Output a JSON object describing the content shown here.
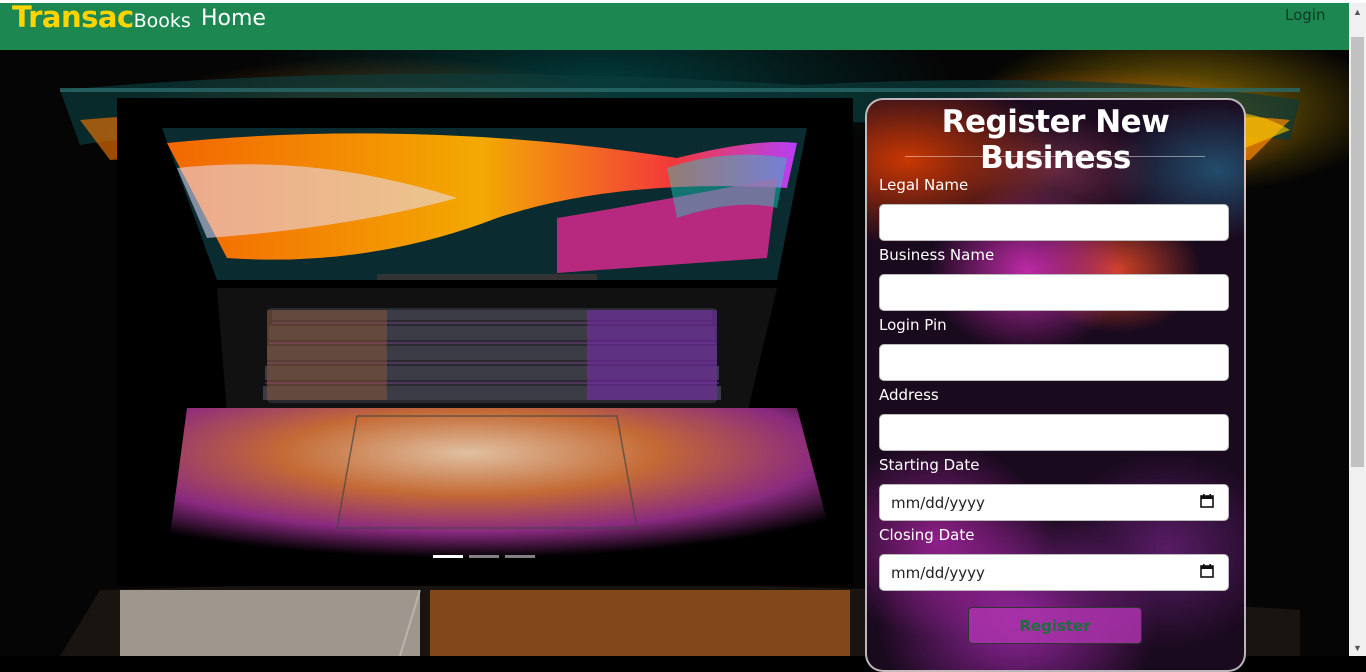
{
  "navbar": {
    "brand_main": "Transac",
    "brand_sub": "Books",
    "home_label": "Home",
    "login_label": "Login",
    "color": "#1d8752",
    "brand_color": "#ffd400"
  },
  "carousel": {
    "image": "laptop-photo",
    "slide_count": 3,
    "active_slide": 1
  },
  "form": {
    "title": "Register New Business",
    "fields": [
      {
        "label": "Legal Name",
        "value": ""
      },
      {
        "label": "Business Name",
        "value": ""
      },
      {
        "label": "Login Pin",
        "value": ""
      },
      {
        "label": "Address",
        "value": ""
      },
      {
        "label": "Starting Date",
        "value": "",
        "placeholder": "mm/dd/yyyy"
      },
      {
        "label": "Closing Date",
        "value": "",
        "placeholder": "mm/dd/yyyy"
      }
    ],
    "submit_label": "Register"
  },
  "icons": {
    "calendar": "calendar-icon",
    "scroll_up": "scroll-up-arrow-icon",
    "scroll_down": "scroll-down-arrow-icon"
  }
}
